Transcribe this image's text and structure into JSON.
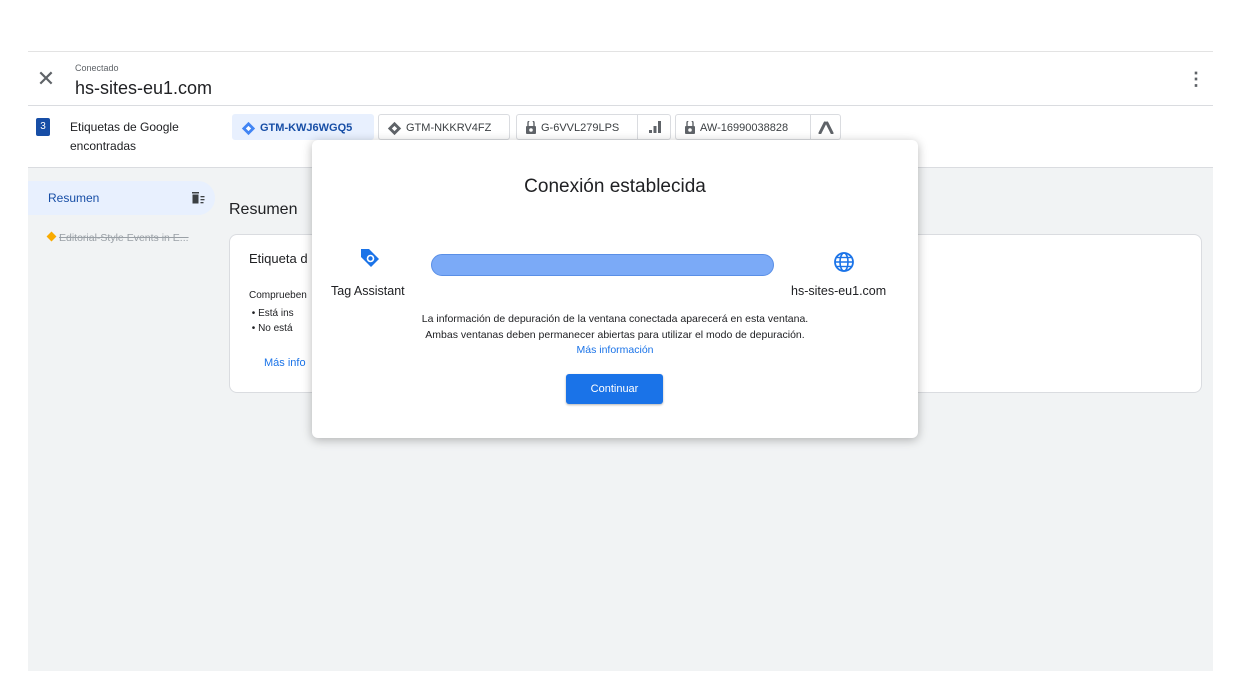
{
  "header": {
    "status": "Conectado",
    "domain": "hs-sites-eu1.com"
  },
  "tags_bar": {
    "count": "3",
    "label": "Etiquetas de Google encontradas",
    "chips": [
      {
        "label": "GTM-KWJ6WGQ5",
        "icon": "gtm-diamond-icon",
        "active": true
      },
      {
        "label": "GTM-NKKRV4FZ",
        "icon": "gtm-diamond-icon",
        "active": false
      },
      {
        "label": "G-6VVL279LPS",
        "icon": "google-tag-icon",
        "extra_icon": "analytics-icon",
        "active": false
      },
      {
        "label": "AW-16990038828",
        "icon": "google-tag-icon",
        "extra_icon": "google-ads-icon",
        "active": false
      }
    ]
  },
  "sidebar": {
    "summary_label": "Resumen",
    "event": "Editorial-Style Events in E..."
  },
  "main": {
    "title": "Resumen",
    "card": {
      "title": "Etiqueta d",
      "description": "Comprueben",
      "bullets": [
        "Está ins",
        "No está"
      ],
      "link": "Más info"
    }
  },
  "dialog": {
    "title": "Conexión establecida",
    "left_label": "Tag Assistant",
    "right_label": "hs-sites-eu1.com",
    "info_line1": "La información de depuración de la ventana conectada aparecerá en esta ventana.",
    "info_line2": "Ambas ventanas deben permanecer abiertas para utilizar el modo de depuración.",
    "link": "Más información",
    "button": "Continuar"
  },
  "colors": {
    "accent": "#1a73e8",
    "selected_bg": "#e8f0fe",
    "connection_bar": "#7baaf7",
    "gtm_blue": "#4285f4"
  }
}
